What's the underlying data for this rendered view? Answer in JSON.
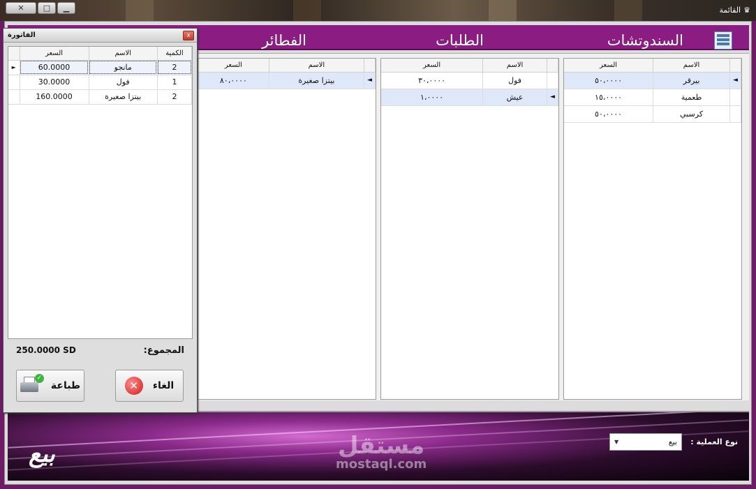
{
  "window": {
    "title": "القائمة",
    "min_btn": "▭",
    "max_btn": "□",
    "close_btn": "✕"
  },
  "categories": [
    {
      "title": "السندوتشات"
    },
    {
      "title": "الطلبات"
    },
    {
      "title": "الفطائر"
    }
  ],
  "grids": {
    "sandwiches": {
      "headers": [
        "الاسم",
        "السعر"
      ],
      "rows": [
        {
          "name": "بيرقر",
          "price": "٥٠،٠٠٠٠",
          "marker": "◄"
        },
        {
          "name": "طعمية",
          "price": "١٥،٠٠٠٠",
          "marker": ""
        },
        {
          "name": "كرسبي",
          "price": "٥٠،٠٠٠٠",
          "marker": ""
        }
      ]
    },
    "orders": {
      "headers": [
        "الاسم",
        "السعر"
      ],
      "rows": [
        {
          "name": "فول",
          "price": "٣٠،٠٠٠٠",
          "marker": ""
        },
        {
          "name": "عيش",
          "price": "١،٠٠٠٠",
          "marker": "◄"
        }
      ]
    },
    "pies": {
      "headers": [
        "الاسم",
        "السعر"
      ],
      "rows": [
        {
          "name": "بيتزا صغيرة",
          "price": "٨٠،٠٠٠٠",
          "marker": "◄"
        }
      ]
    }
  },
  "invoice": {
    "title": "الفاتورة",
    "close": "x",
    "headers": [
      "الكمية",
      "الاسم",
      "السعر"
    ],
    "rows": [
      {
        "qty": "2",
        "name": "مانجو",
        "price": "60.0000",
        "marker": "►"
      },
      {
        "qty": "1",
        "name": "فول",
        "price": "30.0000",
        "marker": ""
      },
      {
        "qty": "2",
        "name": "بيتزا صغيرة",
        "price": "160.0000",
        "marker": ""
      }
    ],
    "total_label": "المجموع:",
    "total_value": "250.0000 SD",
    "print_label": "طباعة",
    "cancel_label": "الغاء"
  },
  "bottom": {
    "sell_label": "بيع",
    "op_type_label": "نوع العملية :",
    "op_type_value": "بيع",
    "watermark_ar": "مستقل",
    "watermark_en": "mostaql.com"
  },
  "colors": {
    "accent": "#8a1c82",
    "selected_row": "#dfe8f8"
  }
}
